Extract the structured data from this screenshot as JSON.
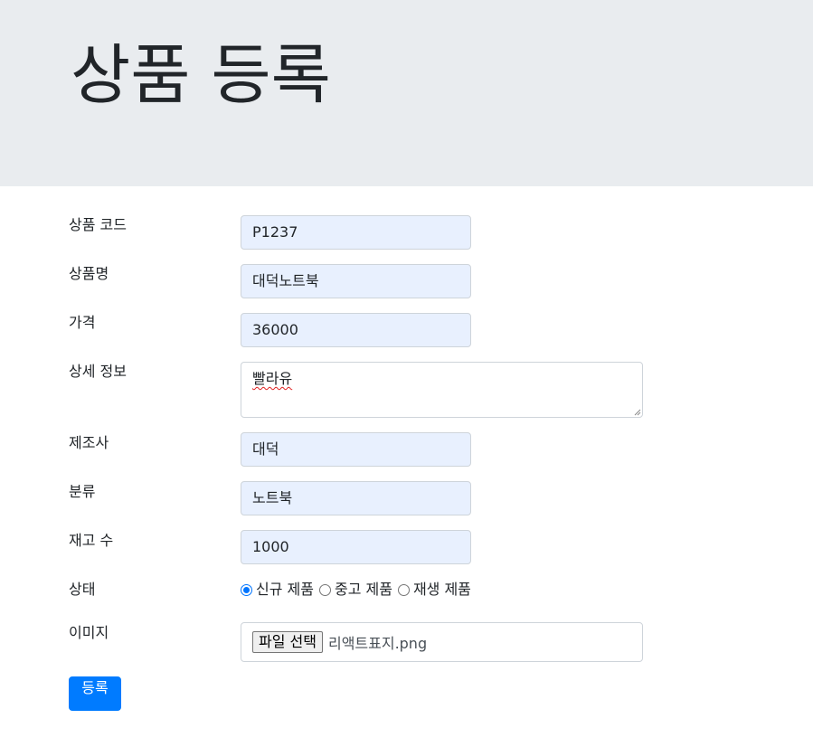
{
  "page": {
    "title": "상품 등록"
  },
  "form": {
    "product_code": {
      "label": "상품 코드",
      "value": "P1237"
    },
    "product_name": {
      "label": "상품명",
      "value": "대덕노트북"
    },
    "price": {
      "label": "가격",
      "value": "36000"
    },
    "description": {
      "label": "상세 정보",
      "value": "빨라유"
    },
    "manufacturer": {
      "label": "제조사",
      "value": "대덕"
    },
    "category": {
      "label": "분류",
      "value": "노트북"
    },
    "stock": {
      "label": "재고 수",
      "value": "1000"
    },
    "condition": {
      "label": "상태",
      "options": [
        {
          "label": "신규 제품",
          "checked": true
        },
        {
          "label": "중고 제품",
          "checked": false
        },
        {
          "label": "재생 제품",
          "checked": false
        }
      ]
    },
    "image": {
      "label": "이미지",
      "button_label": "파일 선택",
      "file_name": "리액트표지.png"
    },
    "submit_label": "등록"
  },
  "colors": {
    "jumbotron_bg": "#e9ecef",
    "autofill_bg": "#e8f0fe",
    "primary": "#007bff",
    "radio_checked": "#0075ff"
  }
}
